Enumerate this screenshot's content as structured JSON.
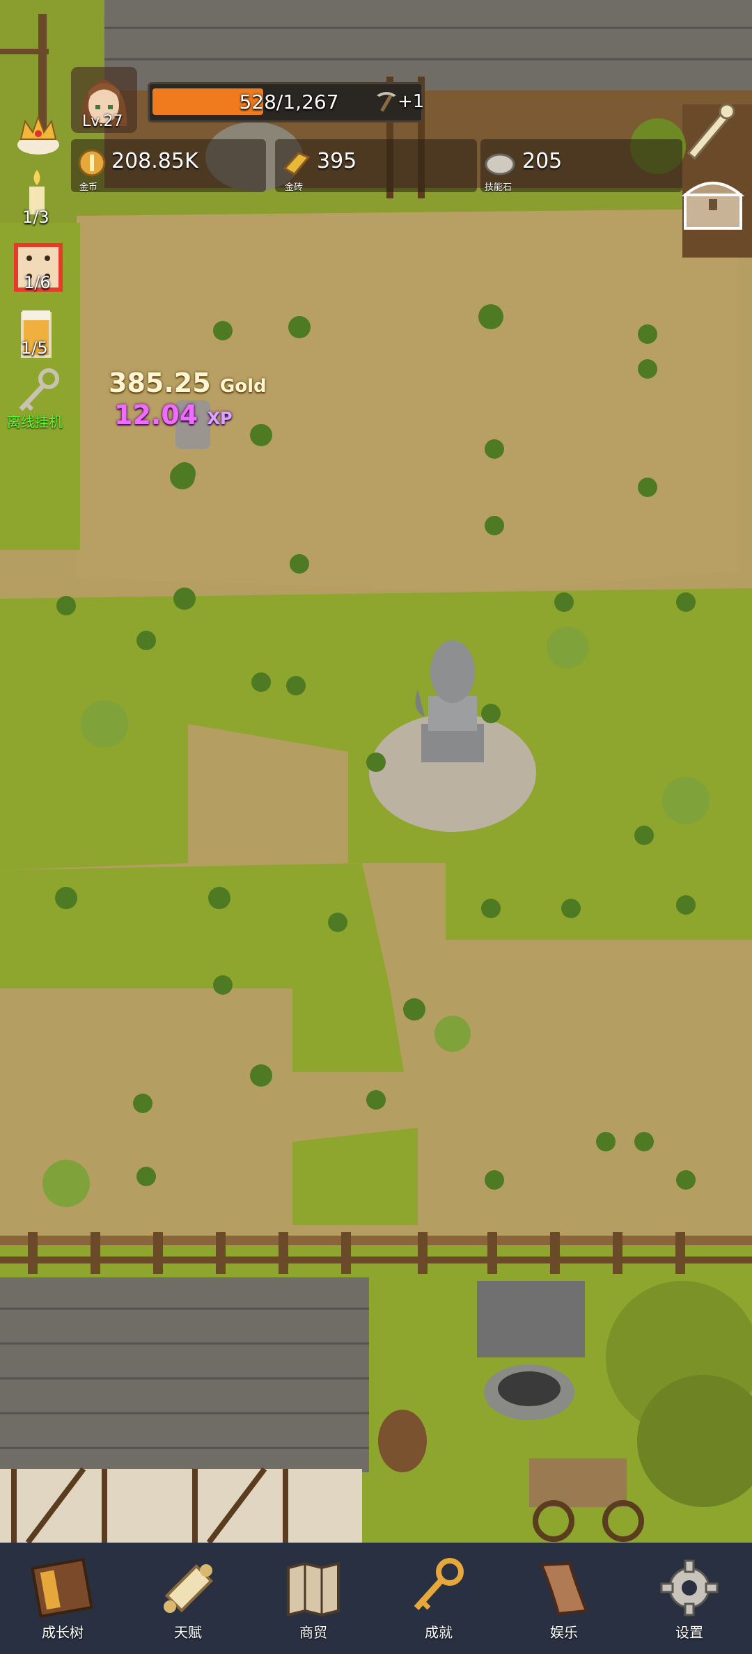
{
  "player": {
    "level": "Lv.27",
    "xp_current": "528",
    "xp_max": "1,267",
    "xp_fraction": 0.417,
    "pickaxe_bonus": "+1"
  },
  "resources": [
    {
      "icon": "gold-coin-icon",
      "value": "208.85K",
      "caption": "金币"
    },
    {
      "icon": "gold-brick-icon",
      "value": "395",
      "caption": "金砖"
    },
    {
      "icon": "skill-stone-icon",
      "value": "205",
      "caption": "技能石"
    }
  ],
  "side_items": {
    "candle_count": "1/3",
    "dice_count": "1/6",
    "beer_count": "1/5",
    "idle_label": "离线挂机"
  },
  "floating": {
    "gold_amount": "385.25",
    "gold_unit": "Gold",
    "xp_amount": "12.04",
    "xp_unit": "XP"
  },
  "nav": [
    {
      "icon": "book-icon",
      "label": "成长树"
    },
    {
      "icon": "scroll-icon",
      "label": "天赋"
    },
    {
      "icon": "map-icon",
      "label": "商贸"
    },
    {
      "icon": "key-icon",
      "label": "成就"
    },
    {
      "icon": "parchment-icon",
      "label": "娱乐"
    },
    {
      "icon": "gear-icon",
      "label": "设置"
    }
  ],
  "colors": {
    "dirt": "#b59e62",
    "grass": "#8ea52e",
    "roof": "#6f6d66",
    "nav_bg": "#283041",
    "xp_bar": "#f07a1e"
  }
}
